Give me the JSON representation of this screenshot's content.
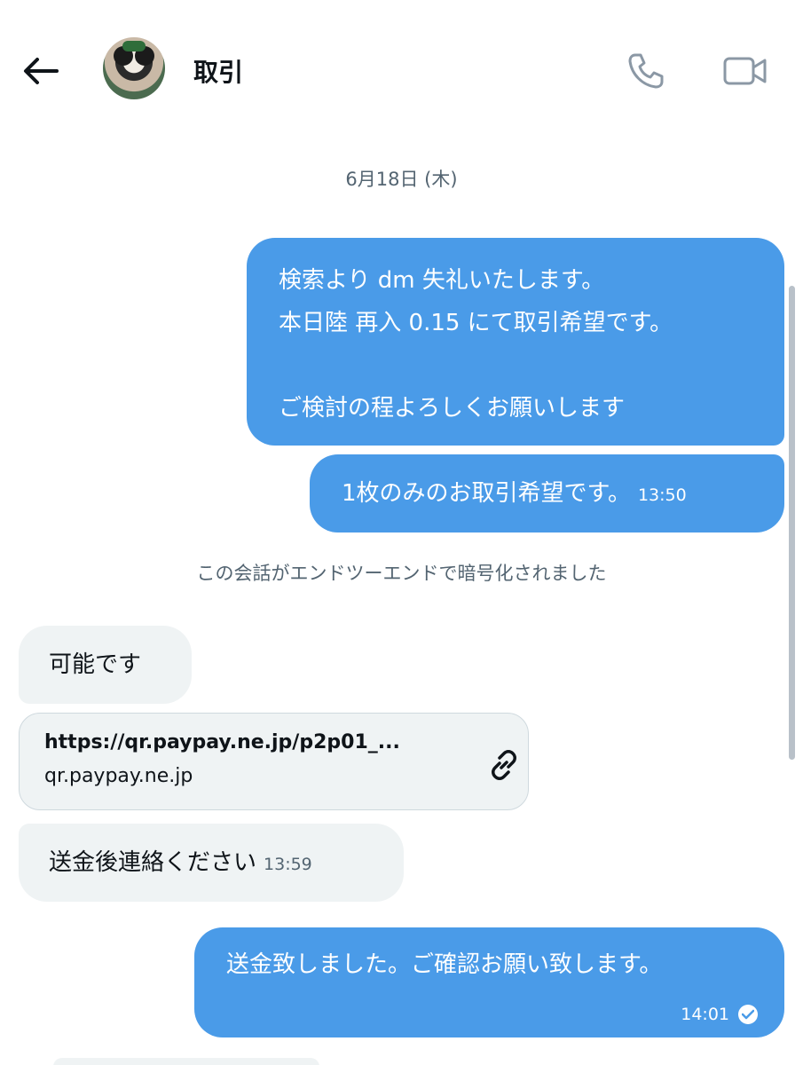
{
  "header": {
    "title": "取引",
    "back_icon": "back-arrow-icon",
    "phone_icon": "phone-icon",
    "video_icon": "video-camera-icon"
  },
  "date_separator": "6月18日 (木)",
  "messages": [
    {
      "direction": "outgoing",
      "lines": [
        "検索より dm 失礼いたします。",
        "本日陸 再入 0.15 にて取引希望です。",
        "",
        "ご検討の程よろしくお願いします"
      ]
    },
    {
      "direction": "outgoing",
      "text": "1枚のみのお取引希望です。",
      "time": "13:50"
    },
    {
      "direction": "incoming",
      "text": "可能です"
    },
    {
      "direction": "incoming",
      "type": "link",
      "url": "https://qr.paypay.ne.jp/p2p01_...",
      "domain": "qr.paypay.ne.jp"
    },
    {
      "direction": "incoming",
      "text": "送金後連絡ください",
      "time": "13:59"
    },
    {
      "direction": "outgoing",
      "text": "送金致しました。ご確認お願い致します。",
      "time": "14:01",
      "status_icon": "read-check-icon"
    }
  ],
  "encryption_notice": "この会話がエンドツーエンドで暗号化されました",
  "colors": {
    "outgoing_bubble": "#4a9be8",
    "incoming_bubble": "#eff3f4",
    "meta_text": "#536471"
  }
}
